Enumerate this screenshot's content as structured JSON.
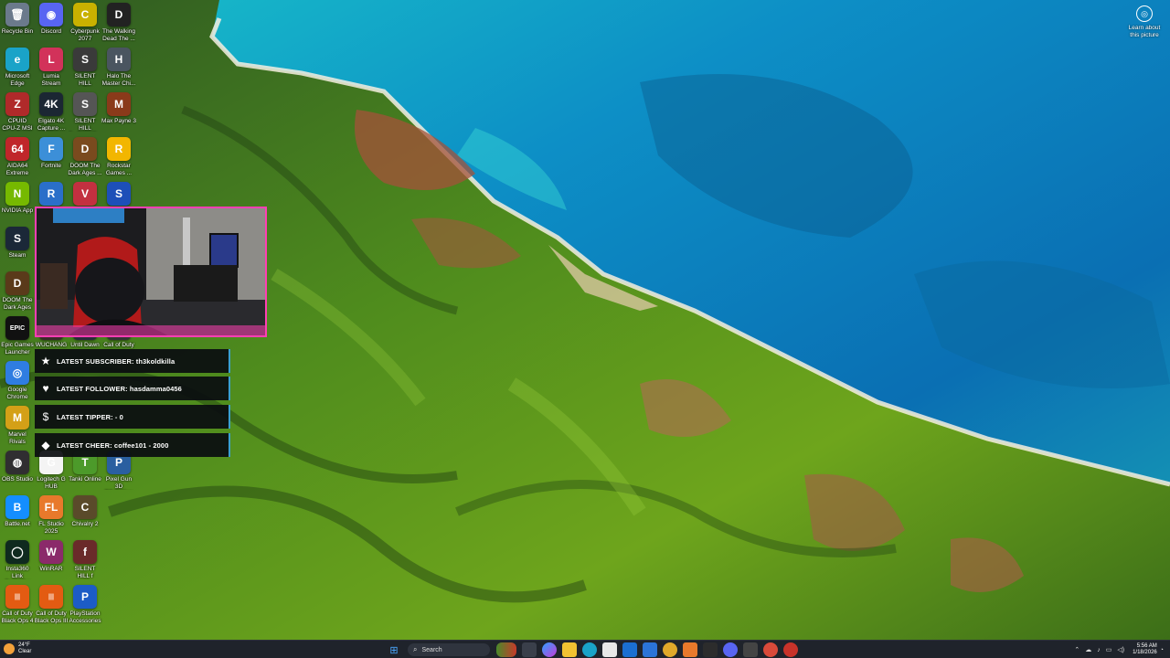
{
  "desktop": {
    "icons": [
      {
        "label": "Recycle Bin",
        "icon": "recycle-bin-icon",
        "color": "#6b7a8c",
        "glyph": "🗑"
      },
      {
        "label": "Discord",
        "icon": "discord-icon",
        "color": "#5865f2",
        "glyph": "◉"
      },
      {
        "label": "Cyberpunk\n2077",
        "icon": "cyberpunk-icon",
        "color": "#c9b100",
        "glyph": "C"
      },
      {
        "label": "The Walking\nDead The ...",
        "icon": "walking-dead-icon",
        "color": "#222222",
        "glyph": "D"
      },
      {
        "label": "Microsoft\nEdge",
        "icon": "edge-icon",
        "color": "#1aa3c8",
        "glyph": "e"
      },
      {
        "label": "Lumia\nStream",
        "icon": "lumia-stream-icon",
        "color": "#d2325a",
        "glyph": "L"
      },
      {
        "label": "SILENT HILL\n2",
        "icon": "silent-hill-2-icon",
        "color": "#3a3a3a",
        "glyph": "S"
      },
      {
        "label": "Halo The\nMaster Chi...",
        "icon": "halo-icon",
        "color": "#4a5560",
        "glyph": "H"
      },
      {
        "label": "CPUID\nCPU-Z MSI",
        "icon": "cpuz-icon",
        "color": "#b02a2a",
        "glyph": "Z"
      },
      {
        "label": "Elgato 4K\nCapture ...",
        "icon": "elgato-icon",
        "color": "#1b2733",
        "glyph": "4K"
      },
      {
        "label": "SILENT HILL\n2 - Soundt...",
        "icon": "silent-hill-soundtrack-icon",
        "color": "#555555",
        "glyph": "S"
      },
      {
        "label": "Max Payne 3",
        "icon": "max-payne-icon",
        "color": "#8a3a1a",
        "glyph": "M"
      },
      {
        "label": "AIDA64\nExtreme",
        "icon": "aida64-icon",
        "color": "#c0262a",
        "glyph": "64"
      },
      {
        "label": "Fortnite",
        "icon": "fortnite-icon",
        "color": "#3c8fd8",
        "glyph": "F"
      },
      {
        "label": "DOOM The\nDark Ages ...",
        "icon": "doom-dark-ages-icon",
        "color": "#7a4a1e",
        "glyph": "D"
      },
      {
        "label": "Rockstar\nGames ...",
        "icon": "rockstar-icon",
        "color": "#f2b600",
        "glyph": "R"
      },
      {
        "label": "NVIDIA App",
        "icon": "nvidia-icon",
        "color": "#76b900",
        "glyph": "N"
      },
      {
        "label": "",
        "icon": "rocket-league-icon",
        "color": "#2a6fc9",
        "glyph": "R"
      },
      {
        "label": "",
        "icon": "valorant-icon",
        "color": "#c33040",
        "glyph": "V"
      },
      {
        "label": "",
        "icon": "sonic-icon",
        "color": "#1d4fb8",
        "glyph": "S"
      },
      {
        "label": "Steam",
        "icon": "steam-icon",
        "color": "#1b2838",
        "glyph": "S"
      },
      {
        "label": "DOOM The\nDark Ages",
        "icon": "doom-icon",
        "color": "#5a3a1a",
        "glyph": "D"
      },
      {
        "label": "Epic Games\nLauncher",
        "icon": "epic-games-icon",
        "color": "#111111",
        "glyph": "EPIC"
      },
      {
        "label": "WUCHANG",
        "icon": "wuchang-icon",
        "color": "#3b2a2a",
        "glyph": "W"
      },
      {
        "label": "Until Dawn",
        "icon": "until-dawn-icon",
        "color": "#2a2a3a",
        "glyph": "U"
      },
      {
        "label": "Call of Duty",
        "icon": "call-of-duty-icon",
        "color": "#333333",
        "glyph": "C"
      },
      {
        "label": "Google\nChrome",
        "icon": "chrome-icon",
        "color": "#2f7de1",
        "glyph": "◎"
      },
      {
        "label": "Marvel Rivals",
        "icon": "marvel-rivals-icon",
        "color": "#d4a017",
        "glyph": "M"
      },
      {
        "label": "OBS Studio",
        "icon": "obs-icon",
        "color": "#302e31",
        "glyph": "◍"
      },
      {
        "label": "Logitech G\nHUB",
        "icon": "logitech-icon",
        "color": "#f4f4f4",
        "glyph": "G"
      },
      {
        "label": "Tanki Online",
        "icon": "tanki-icon",
        "color": "#4c9a2a",
        "glyph": "T"
      },
      {
        "label": "Pixel Gun 3D\nPC Edition",
        "icon": "pixel-gun-icon",
        "color": "#2a5fa0",
        "glyph": "P"
      },
      {
        "label": "Battle.net",
        "icon": "battlenet-icon",
        "color": "#148eff",
        "glyph": "B"
      },
      {
        "label": "FL Studio\n2025",
        "icon": "fl-studio-icon",
        "color": "#e8792b",
        "glyph": "FL"
      },
      {
        "label": "Chivalry 2",
        "icon": "chivalry-icon",
        "color": "#5a4a2a",
        "glyph": "C"
      },
      {
        "label": "Insta360 Link\nController",
        "icon": "insta360-icon",
        "color": "#0f2a1f",
        "glyph": "◯"
      },
      {
        "label": "WinRAR",
        "icon": "winrar-icon",
        "color": "#8b2a6a",
        "glyph": "W"
      },
      {
        "label": "SILENT HILL f",
        "icon": "silent-hill-f-icon",
        "color": "#6a2a2a",
        "glyph": "f"
      },
      {
        "label": "Call of Duty\nBlack Ops 4",
        "icon": "cod-bo4-icon",
        "color": "#e35b12",
        "glyph": "|||"
      },
      {
        "label": "Call of Duty\nBlack Ops III",
        "icon": "cod-bo3-icon",
        "color": "#e35b12",
        "glyph": "|||"
      },
      {
        "label": "PlayStation\nAccessories",
        "icon": "playstation-icon",
        "color": "#1c5cc6",
        "glyph": "P"
      }
    ]
  },
  "overlay": {
    "alerts": [
      {
        "icon": "★",
        "icon_name": "star-icon",
        "text": "LATEST SUBSCRIBER: th3koldkilla"
      },
      {
        "icon": "♥",
        "icon_name": "heart-icon",
        "text": "LATEST FOLLOWER: hasdamma0456"
      },
      {
        "icon": "$",
        "icon_name": "dollar-icon",
        "text": "LATEST TIPPER: - 0"
      },
      {
        "icon": "◆",
        "icon_name": "diamond-icon",
        "text": "LATEST CHEER: coffee101 - 2000"
      }
    ]
  },
  "learn_about": {
    "label": "Learn about\nthis picture"
  },
  "taskbar": {
    "weather_temp": "24°F",
    "weather_condition": "Clear",
    "search_placeholder": "Search",
    "time": "5:56 AM",
    "date": "1/18/2026"
  }
}
